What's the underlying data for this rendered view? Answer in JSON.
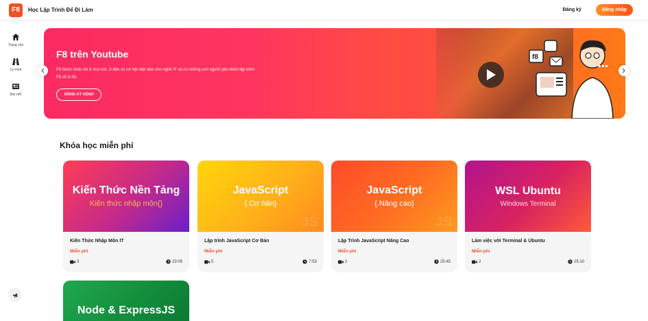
{
  "header": {
    "logo_text": "F8",
    "brand": "Học Lập Trình Để Đi Làm",
    "register_label": "Đăng ký",
    "login_label": "Đăng nhập"
  },
  "sidebar": {
    "items": [
      {
        "label": "Trang chủ",
        "icon": "home-icon"
      },
      {
        "label": "Lộ trình",
        "icon": "road-icon"
      },
      {
        "label": "Bài viết",
        "icon": "newspaper-icon"
      }
    ]
  },
  "banner": {
    "title": "F8 trên Youtube",
    "description": "F8 được nhắc tới ở mọi nơi, ở đâu có cơ hội việc làm cho nghề IT và có những con người yêu thích lập trình F8 sẽ ở đó.",
    "button_label": "ĐĂNG KÝ KÊNH",
    "colors": {
      "start": "#fb2a62",
      "end": "#ff7a17"
    }
  },
  "section": {
    "title": "Khóa học miễn phí"
  },
  "courses": [
    {
      "thumb_title": "Kiến Thức Nền Tảng",
      "thumb_sub": "Kiến thức nhập môn{}",
      "name": "Kiến Thức Nhập Môn IT",
      "price": "Miễn phí",
      "videos": "3",
      "duration": "23:09"
    },
    {
      "thumb_title": "JavaScript",
      "thumb_sub": "{.Cơ bản}",
      "name": "Lập trình JavaScript Cơ Bản",
      "price": "Miễn phí",
      "videos": "5",
      "duration": "7:53"
    },
    {
      "thumb_title": "JavaScript",
      "thumb_sub": "{.Nâng cao}",
      "name": "Lập Trình JavaScript Nâng Cao",
      "price": "Miễn phí",
      "videos": "2",
      "duration": "25:45"
    },
    {
      "thumb_title": "WSL Ubuntu",
      "thumb_sub": "Windows Terminal",
      "name": "Làm việc với Terminal & Ubuntu",
      "price": "Miễn phí",
      "videos": "2",
      "duration": "25:10"
    },
    {
      "thumb_title": "Node & ExpressJS"
    }
  ]
}
